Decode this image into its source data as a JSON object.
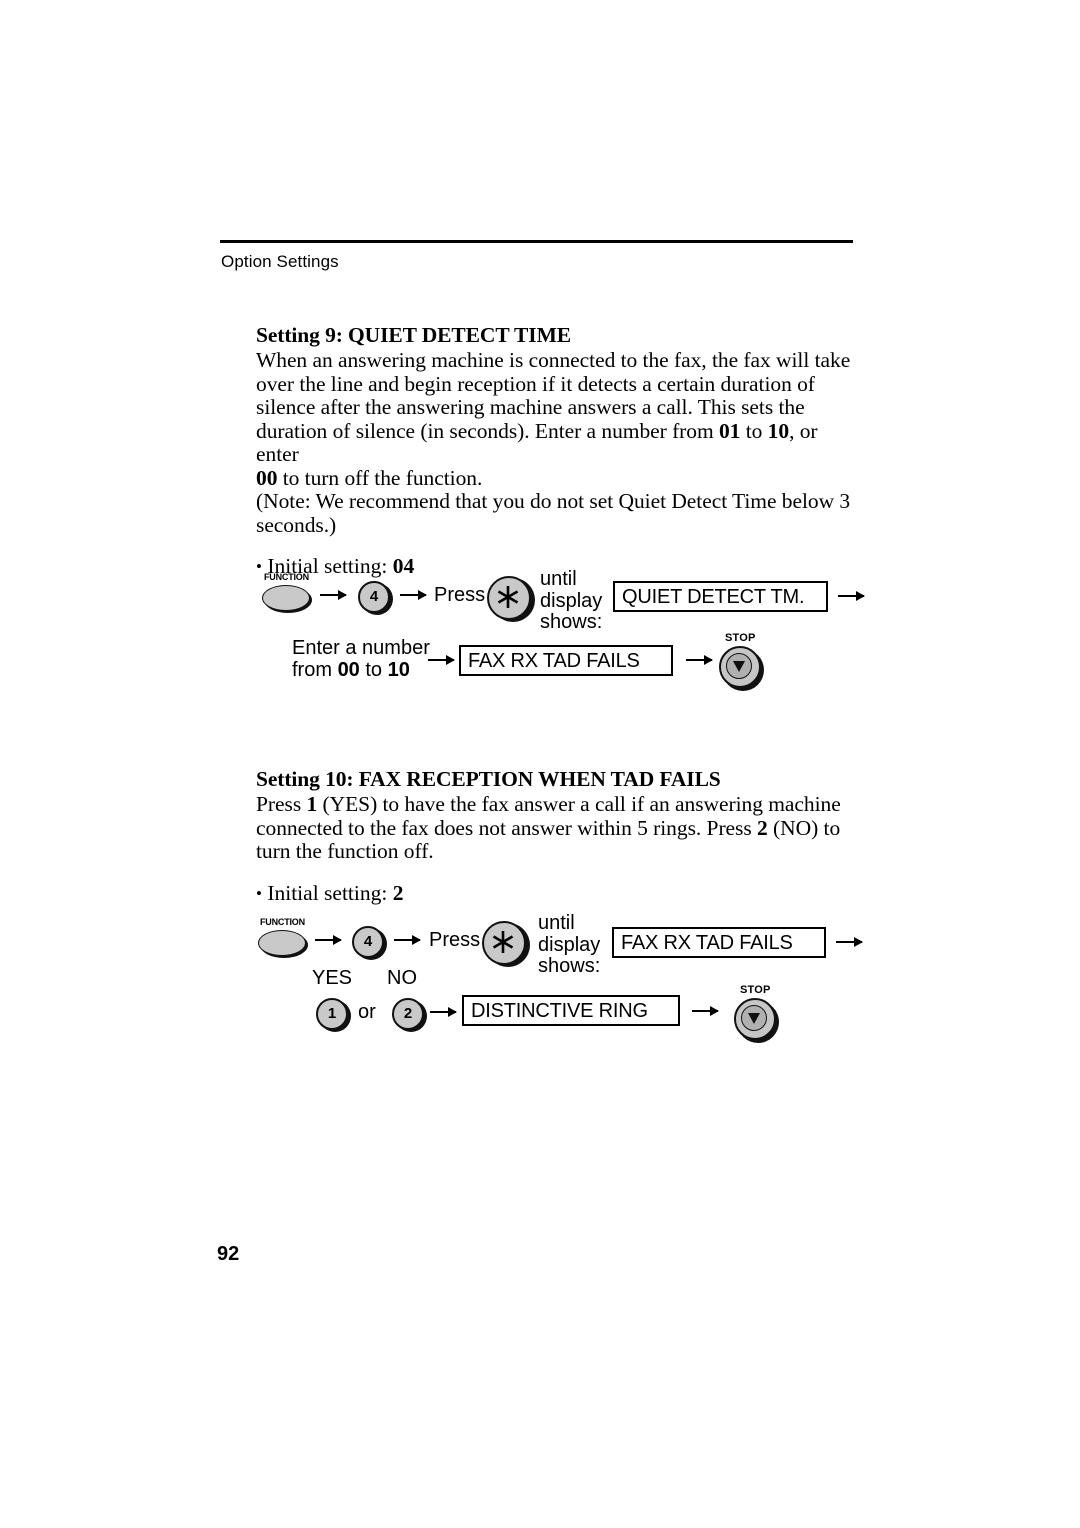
{
  "header": {
    "running_head": "Option Settings"
  },
  "sections": [
    {
      "heading": "Setting 9: QUIET DETECT TIME",
      "body_lines": [
        "When an answering machine is connected to the fax, the fax will take",
        "over the line and begin reception if it detects a certain duration of",
        "silence after the answering machine answers a call. This sets the",
        "duration of silence (in seconds). Enter a number from 01 to 10, or enter",
        "00 to turn off the function.",
        "(Note: We recommend that you do not set Quiet Detect Time below 3",
        "seconds.)"
      ],
      "initial_setting_label": "Initial setting:",
      "initial_setting_value": "04"
    },
    {
      "heading": "Setting 10: FAX RECEPTION WHEN TAD FAILS",
      "body_lines": [
        "Press 1 (YES) to have the fax answer a call if an answering machine",
        "connected to the fax does not answer within 5 rings. Press 2 (NO) to",
        "turn the function off."
      ],
      "initial_setting_label": "Initial setting:",
      "initial_setting_value": "2"
    }
  ],
  "procedure_1": {
    "function_key_label": "FUNCTION",
    "number_key": "4",
    "press_label": "Press",
    "star_key_glyph": "asterisk",
    "until_display_shows": "until\ndisplay\nshows:",
    "until_line_1": "until",
    "until_line_2": "display",
    "until_line_3": "shows:",
    "display_1": "QUIET DETECT TM.",
    "enter_line_1": "Enter a number",
    "enter_line_2_pre": "from ",
    "enter_line_2_from": "00",
    "enter_line_2_mid": " to ",
    "enter_line_2_to": "10",
    "display_2": "FAX RX TAD FAILS",
    "stop_key_label": "STOP"
  },
  "procedure_2": {
    "function_key_label": "FUNCTION",
    "number_key": "4",
    "press_label": "Press",
    "star_key_glyph": "asterisk",
    "until_line_1": "until",
    "until_line_2": "display",
    "until_line_3": "shows:",
    "display_1": "FAX RX TAD FAILS",
    "yes_label": "YES",
    "no_label": "NO",
    "yes_key": "1",
    "or_label": "or",
    "no_key": "2",
    "display_2": "DISTINCTIVE RING",
    "stop_key_label": "STOP"
  },
  "footer": {
    "page_number": "92"
  }
}
